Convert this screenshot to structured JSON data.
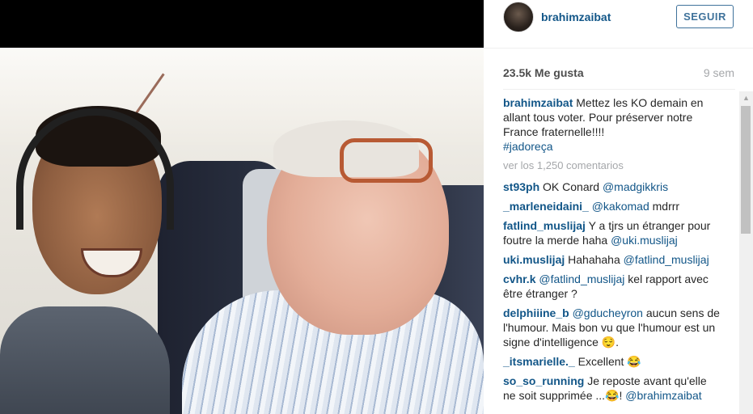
{
  "post": {
    "username": "brahimzaibat",
    "follow_label": "SEGUIR",
    "likes": "23.5k Me gusta",
    "time_ago": "9 sem"
  },
  "caption": {
    "user": "brahimzaibat",
    "text": "Mettez les KO demain en allant tous voter. Pour préserver notre France fraternelle!!!!",
    "hashtag": "#jadoreça"
  },
  "more_comments": "ver los 1,250 comentarios",
  "comments": [
    {
      "user": "st93ph",
      "text": "OK Conard ",
      "mention": "@madgikkris",
      "after": ""
    },
    {
      "user": "_marleneidaini_",
      "text": "",
      "mention": "@kakomad",
      "after": " mdrrr"
    },
    {
      "user": "fatlind_muslijaj",
      "text": "Y a tjrs un étranger pour foutre la merde haha ",
      "mention": "@uki.muslijaj",
      "after": ""
    },
    {
      "user": "uki.muslijaj",
      "text": "Hahahaha ",
      "mention": "@fatlind_muslijaj",
      "after": ""
    },
    {
      "user": "cvhr.k",
      "text": "",
      "mention": "@fatlind_muslijaj",
      "after": " kel rapport avec être étranger ?"
    },
    {
      "user": "delphiiine_b",
      "text": "",
      "mention": "@gducheyron",
      "after": " aucun sens de l'humour. Mais bon vu que l'humour est un signe d'intelligence 😌."
    },
    {
      "user": "_itsmarielle._",
      "text": "Excellent 😂",
      "mention": "",
      "after": ""
    },
    {
      "user": "so_so_running",
      "text": "Je reposte avant qu'elle ne soit supprimée ...😂! ",
      "mention": "@brahimzaibat",
      "after": ""
    }
  ],
  "icons": {
    "avatar": "profile-photo",
    "scroll_up": "scroll-up-arrow-icon"
  },
  "colors": {
    "link": "#125688",
    "button_border": "#3f729b",
    "muted": "#a5a7aa"
  }
}
